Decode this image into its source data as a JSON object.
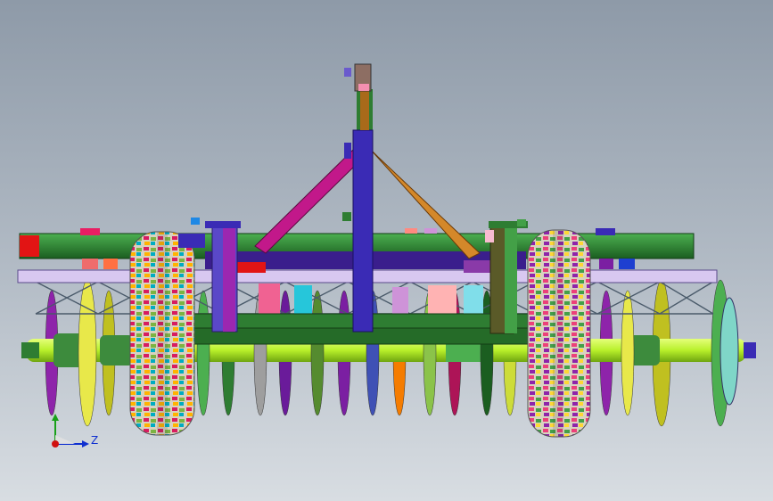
{
  "axis_triad": {
    "z_label": "Z",
    "colors": {
      "x": "#d01010",
      "y": "#18a018",
      "z": "#1030d0"
    }
  },
  "palette": {
    "frame_green": "#2e7d32",
    "bar_lavender": "#d8c8f0",
    "mast_blue": "#3a2bb5",
    "brace_magenta": "#c2188a",
    "brace_orange": "#d4882a",
    "axle_lime": "#b8f02a",
    "red_cap": "#e21414"
  }
}
